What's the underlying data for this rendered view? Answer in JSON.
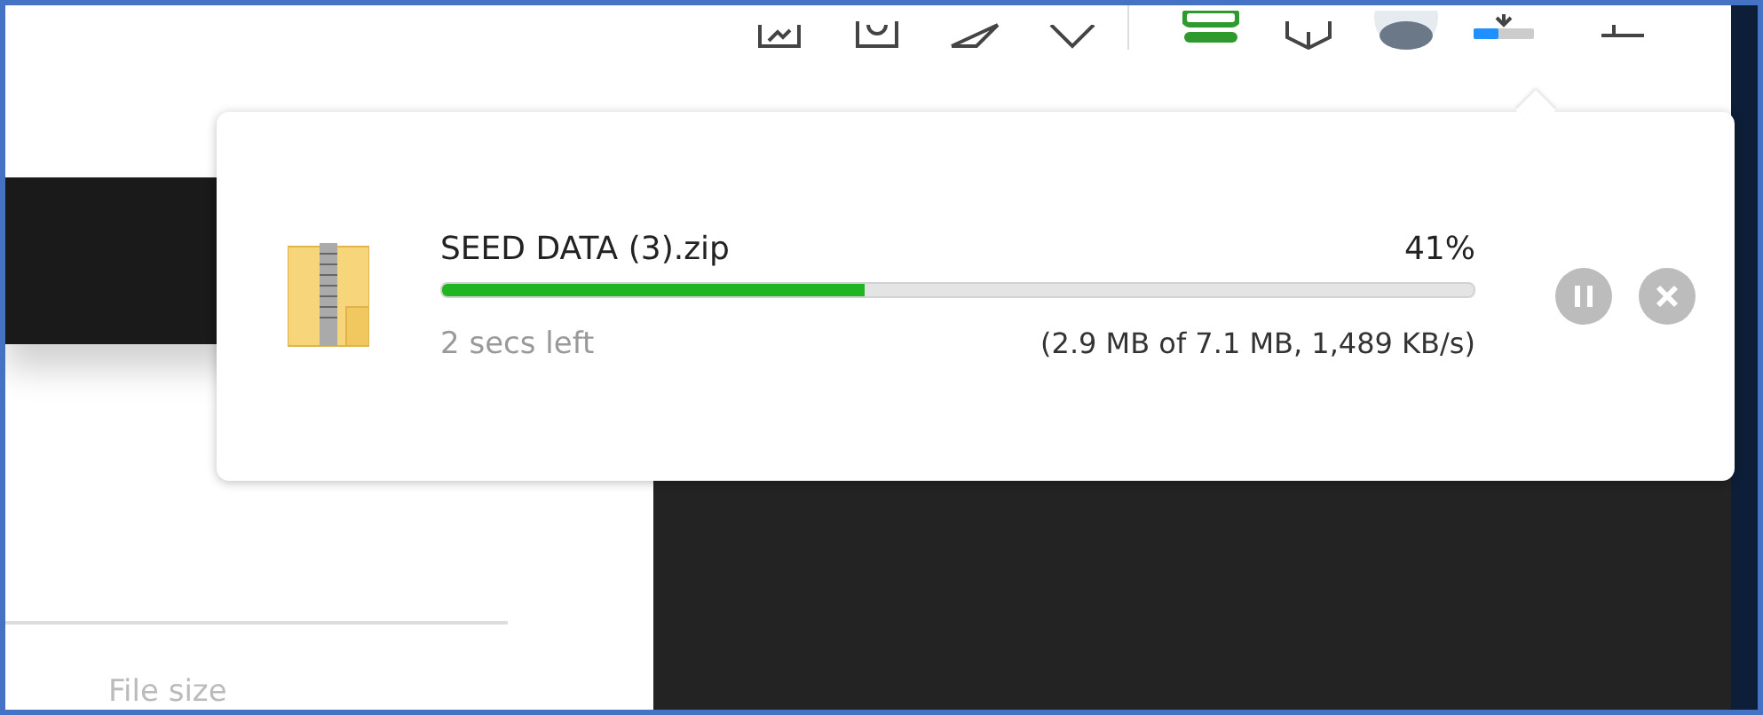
{
  "download": {
    "file_name": "SEED DATA (3).zip",
    "percent": "41%",
    "level": 0.41,
    "time_left": "2 secs left",
    "details": "(2.9 MB of 7.1 MB, 1,489 KB/s)"
  },
  "page": {
    "column_label": "File size"
  }
}
